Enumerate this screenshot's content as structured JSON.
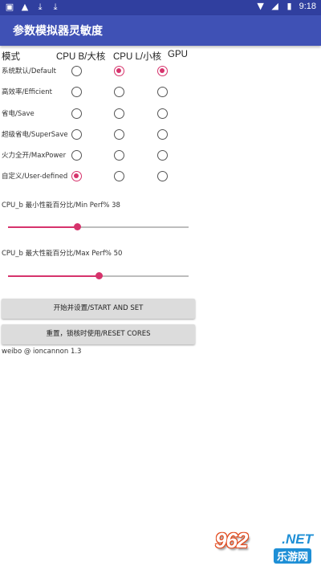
{
  "statusbar": {
    "icons": [
      "image-icon",
      "warning-icon",
      "download-icon",
      "download-icon"
    ],
    "time": "9:18"
  },
  "appbar": {
    "title": "参数模拟器灵敏度"
  },
  "header": {
    "mode": "模式",
    "cpu_big": "CPU B/大核",
    "cpu_little": "CPU L/小核",
    "gpu": "GPU"
  },
  "rows": [
    {
      "label": "系统默认/Default",
      "cpu_big": false,
      "cpu_little": true,
      "gpu": true
    },
    {
      "label": "高效率/Efficient",
      "cpu_big": false,
      "cpu_little": false,
      "gpu": false
    },
    {
      "label": "省电/Save",
      "cpu_big": false,
      "cpu_little": false,
      "gpu": false
    },
    {
      "label": "超级省电/SuperSave",
      "cpu_big": false,
      "cpu_little": false,
      "gpu": false
    },
    {
      "label": "火力全开/MaxPower",
      "cpu_big": false,
      "cpu_little": false,
      "gpu": false
    },
    {
      "label": "自定义/User-defined",
      "cpu_big": true,
      "cpu_little": false,
      "gpu": false
    }
  ],
  "sliders": {
    "min_label": "CPU_b 最小性能百分比/Min Perf% 38",
    "min_value": 38,
    "max_label": "CPU_b 最大性能百分比/Max Perf% 50",
    "max_value": 50
  },
  "buttons": {
    "start": "开始并设置/START AND SET",
    "reset": "重置，锁核时使用/RESET CORES"
  },
  "footer": "weibo @ ioncannon 1.3",
  "watermark": {
    "logo": "962",
    "net": ".NET",
    "cn": "乐游网"
  },
  "colors": {
    "statusbar": "#303f9f",
    "appbar": "#3f51b5",
    "accent": "#d6336c",
    "button": "#dcdcdc"
  }
}
